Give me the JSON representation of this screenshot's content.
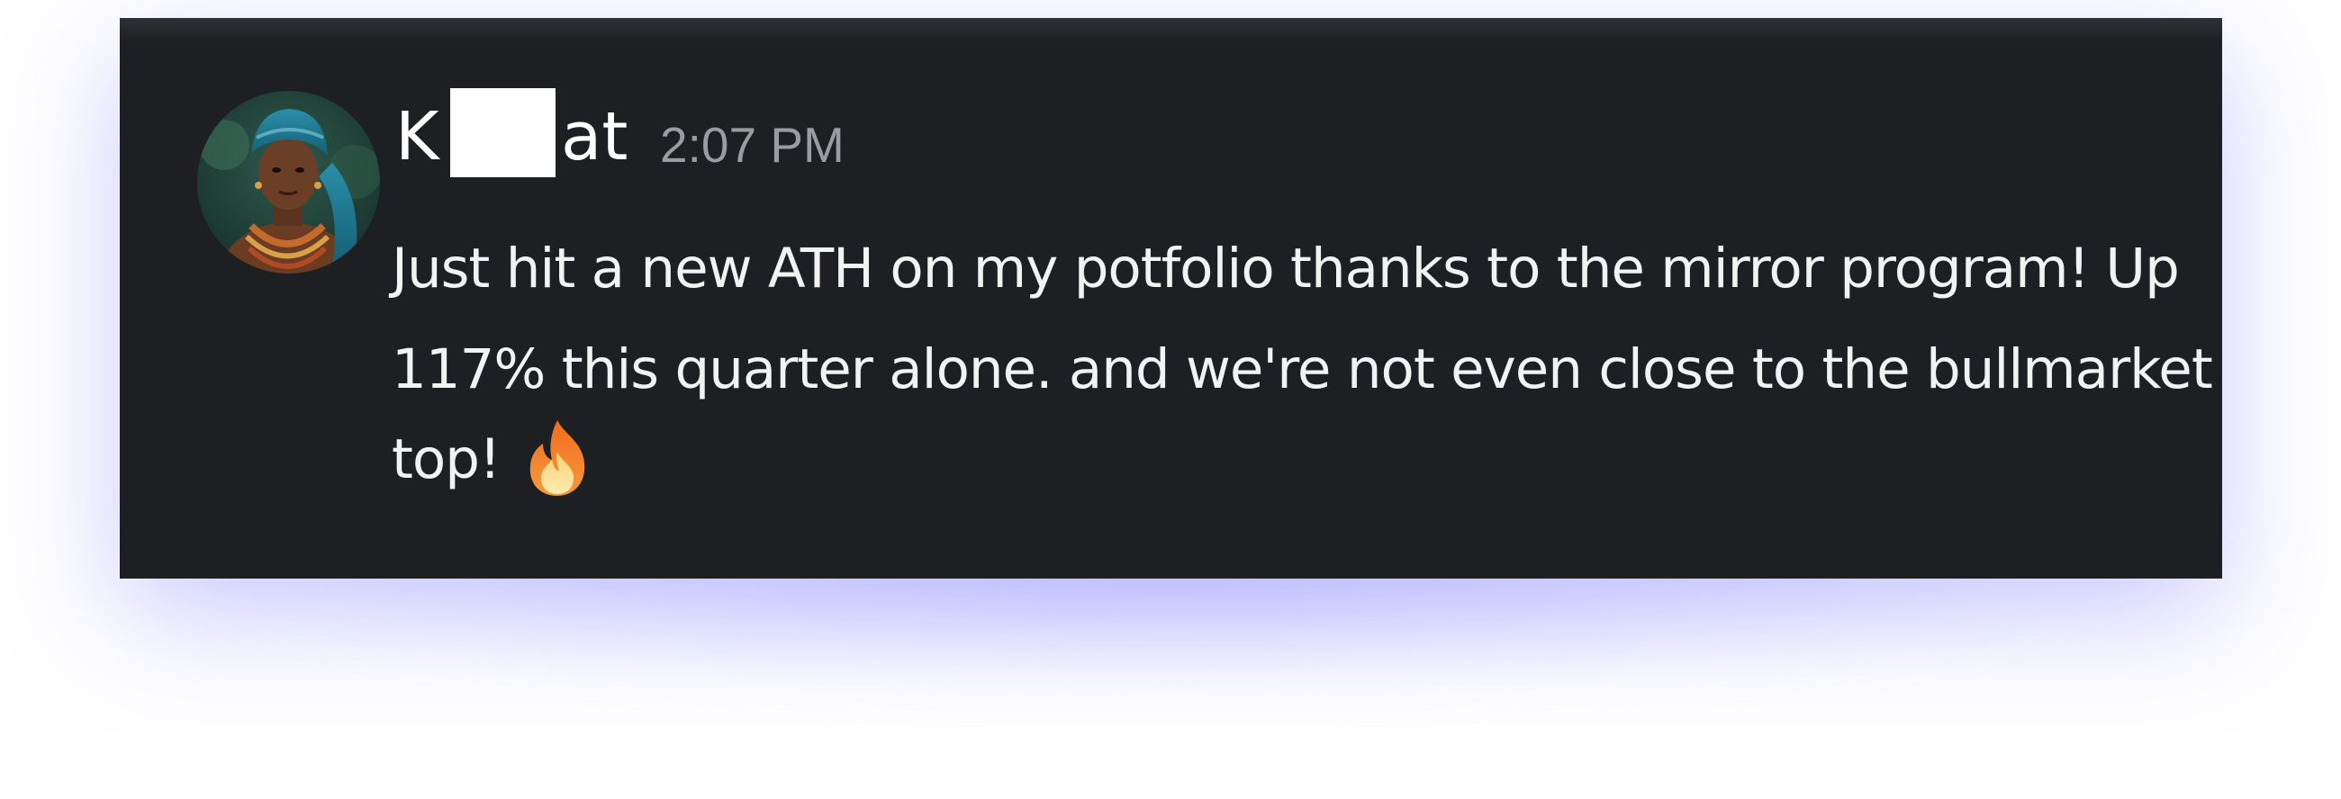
{
  "message": {
    "username_prefix": "K",
    "username_suffix": "at",
    "timestamp": "2:07 PM",
    "body_line1": "Just hit a new ATH on my potfolio thanks to the mirror program! Up",
    "body_line2": "117% this quarter alone. and we're not even close to the bullmarket",
    "body_line3": "top!",
    "emoji": "fire-emoji"
  },
  "colors": {
    "card_background": "#1e1f23",
    "text": "#f2f2f2",
    "timestamp": "#9a9ca3",
    "glow": "#b0b0ff"
  }
}
